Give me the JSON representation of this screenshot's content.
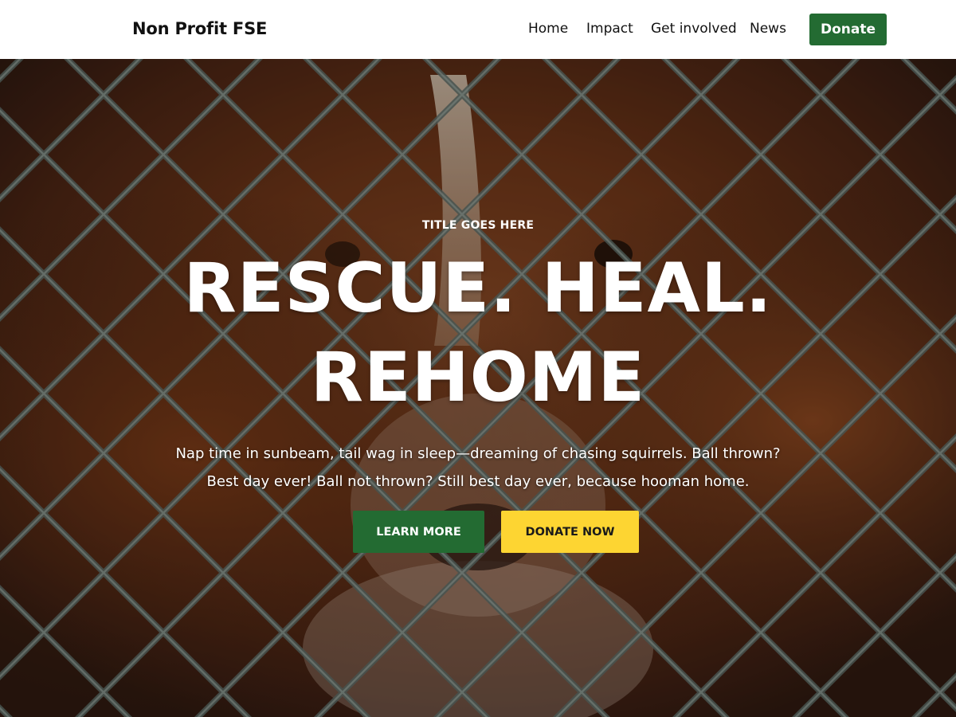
{
  "header": {
    "site_title": "Non Profit FSE",
    "nav": [
      {
        "label": "Home"
      },
      {
        "label": "Impact"
      },
      {
        "label": "Get involved"
      },
      {
        "label": "News"
      }
    ],
    "donate_label": "Donate"
  },
  "hero": {
    "eyebrow": "TITLE GOES HERE",
    "headline_line1": "RESCUE. HEAL.",
    "headline_line2": "REHOME",
    "lead": "Nap time in sunbeam, tail wag in sleep—dreaming of chasing squirrels. Ball thrown? Best day ever! Ball not thrown? Still best day ever, because hooman home.",
    "learn_more_label": "LEARN MORE",
    "donate_now_label": "DONATE NOW"
  },
  "colors": {
    "primary_green": "#236b32",
    "accent_yellow": "#fdd532",
    "header_bg": "#ffffff"
  }
}
